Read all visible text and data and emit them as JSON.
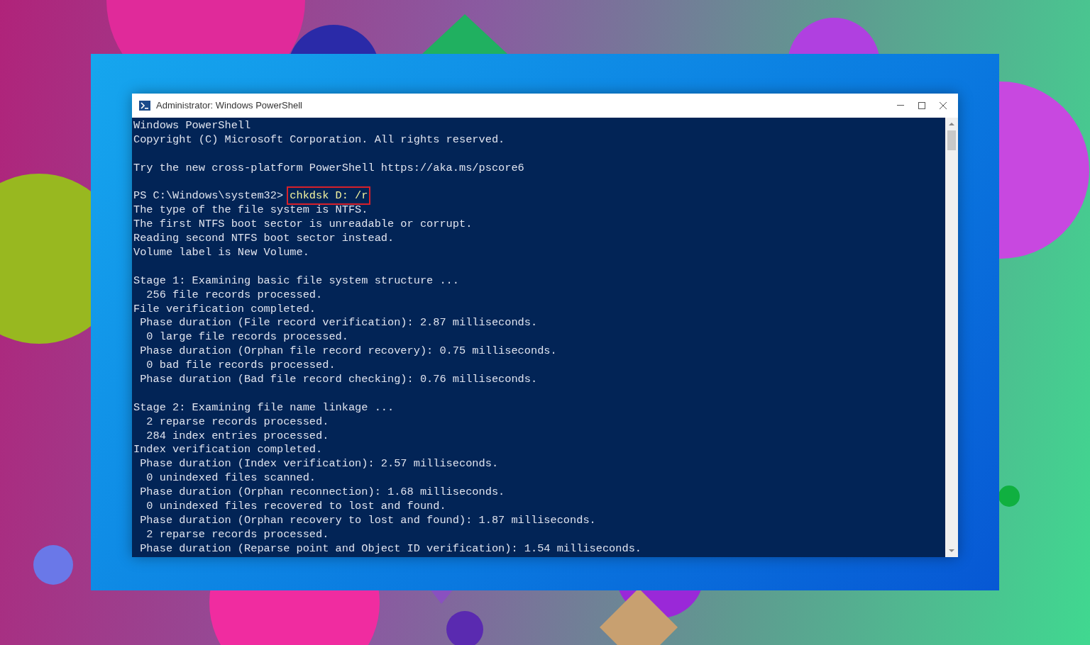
{
  "window": {
    "title": "Administrator: Windows PowerShell"
  },
  "console": {
    "lines": [
      {
        "kind": "text",
        "text": "Windows PowerShell"
      },
      {
        "kind": "text",
        "text": "Copyright (C) Microsoft Corporation. All rights reserved."
      },
      {
        "kind": "blank"
      },
      {
        "kind": "text",
        "text": "Try the new cross-platform PowerShell https://aka.ms/pscore6"
      },
      {
        "kind": "blank"
      },
      {
        "kind": "prompt",
        "prompt": "PS C:\\Windows\\system32>",
        "command": "chkdsk D: /r",
        "highlighted": true
      },
      {
        "kind": "text",
        "text": "The type of the file system is NTFS."
      },
      {
        "kind": "text",
        "text": "The first NTFS boot sector is unreadable or corrupt."
      },
      {
        "kind": "text",
        "text": "Reading second NTFS boot sector instead."
      },
      {
        "kind": "text",
        "text": "Volume label is New Volume."
      },
      {
        "kind": "blank"
      },
      {
        "kind": "text",
        "text": "Stage 1: Examining basic file system structure ..."
      },
      {
        "kind": "text",
        "text": "  256 file records processed."
      },
      {
        "kind": "text",
        "text": "File verification completed."
      },
      {
        "kind": "text",
        "text": " Phase duration (File record verification): 2.87 milliseconds."
      },
      {
        "kind": "text",
        "text": "  0 large file records processed."
      },
      {
        "kind": "text",
        "text": " Phase duration (Orphan file record recovery): 0.75 milliseconds."
      },
      {
        "kind": "text",
        "text": "  0 bad file records processed."
      },
      {
        "kind": "text",
        "text": " Phase duration (Bad file record checking): 0.76 milliseconds."
      },
      {
        "kind": "blank"
      },
      {
        "kind": "text",
        "text": "Stage 2: Examining file name linkage ..."
      },
      {
        "kind": "text",
        "text": "  2 reparse records processed."
      },
      {
        "kind": "text",
        "text": "  284 index entries processed."
      },
      {
        "kind": "text",
        "text": "Index verification completed."
      },
      {
        "kind": "text",
        "text": " Phase duration (Index verification): 2.57 milliseconds."
      },
      {
        "kind": "text",
        "text": "  0 unindexed files scanned."
      },
      {
        "kind": "text",
        "text": " Phase duration (Orphan reconnection): 1.68 milliseconds."
      },
      {
        "kind": "text",
        "text": "  0 unindexed files recovered to lost and found."
      },
      {
        "kind": "text",
        "text": " Phase duration (Orphan recovery to lost and found): 1.87 milliseconds."
      },
      {
        "kind": "text",
        "text": "  2 reparse records processed."
      },
      {
        "kind": "text",
        "text": " Phase duration (Reparse point and Object ID verification): 1.54 milliseconds."
      }
    ]
  }
}
